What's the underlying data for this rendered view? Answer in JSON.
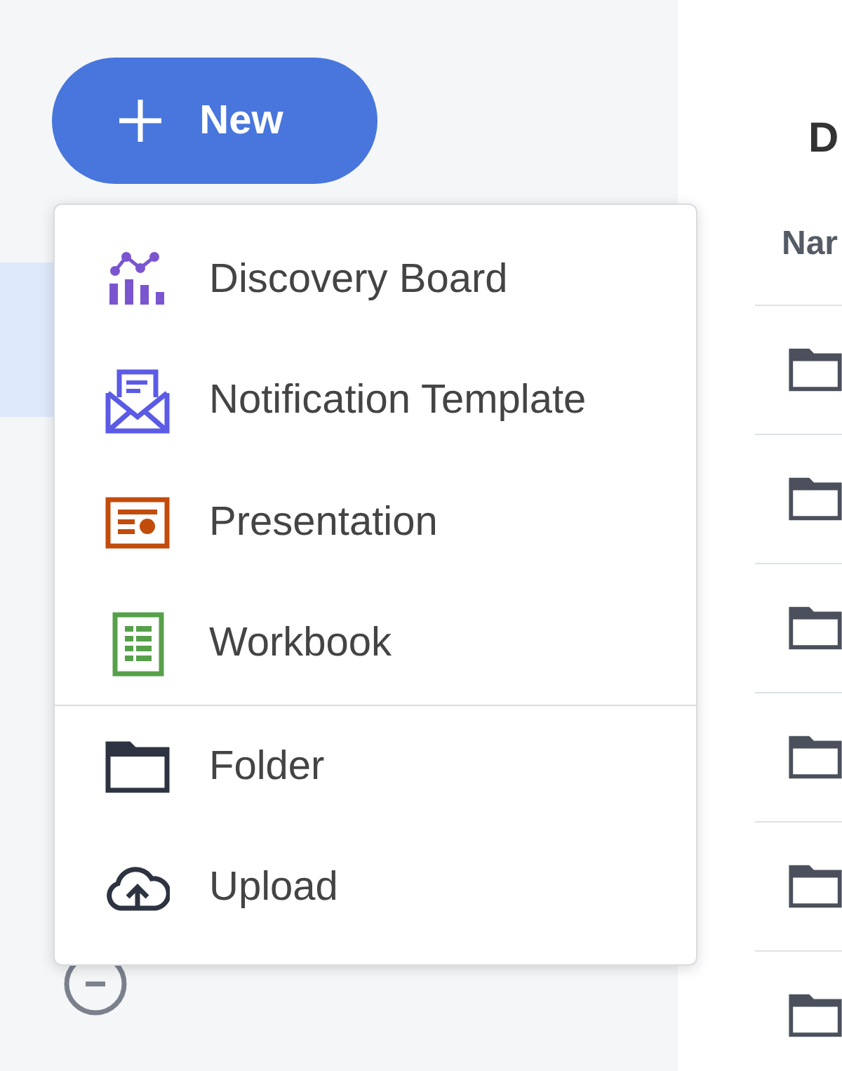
{
  "new_button": {
    "label": "New"
  },
  "sidebar": {
    "items": [
      {
        "selected": true
      },
      {
        "kind": "recent",
        "selected": false
      }
    ]
  },
  "menu": {
    "sections": [
      [
        {
          "kind": "discovery",
          "label": "Discovery Board"
        },
        {
          "kind": "notification",
          "label": "Notification Template"
        },
        {
          "kind": "presentation",
          "label": "Presentation"
        },
        {
          "kind": "workbook",
          "label": "Workbook"
        }
      ],
      [
        {
          "kind": "folder",
          "label": "Folder"
        },
        {
          "kind": "upload",
          "label": "Upload"
        }
      ]
    ]
  },
  "main": {
    "heading": "D",
    "columns": [
      "Nar"
    ],
    "rows": [
      {
        "kind": "folder"
      },
      {
        "kind": "folder"
      },
      {
        "kind": "folder"
      },
      {
        "kind": "folder"
      },
      {
        "kind": "folder"
      },
      {
        "kind": "folder"
      }
    ]
  }
}
